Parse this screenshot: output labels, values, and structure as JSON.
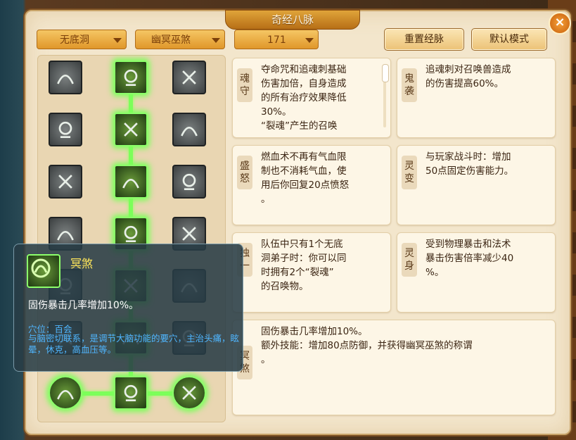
{
  "window": {
    "title": "奇经八脉",
    "close_label": "×"
  },
  "filters": {
    "school": "无底洞",
    "branch": "幽冥巫煞",
    "points": "171"
  },
  "buttons": {
    "reset": "重置经脉",
    "default": "默认模式"
  },
  "tree": {
    "rows": [
      [
        "inactive",
        "active",
        "inactive"
      ],
      [
        "inactive",
        "active",
        "inactive"
      ],
      [
        "inactive",
        "active",
        "inactive"
      ],
      [
        "inactive",
        "active",
        "inactive"
      ],
      [
        "inactive",
        "active",
        "inactive"
      ],
      [
        "inactive",
        "active",
        "inactive"
      ],
      [
        "active",
        "active",
        "active"
      ]
    ],
    "accent": "#7cff5a"
  },
  "skills": [
    {
      "name": "魂守",
      "desc": "夺命咒和追魂刺基础\n伤害加倍，自身造成\n的所有治疗效果降低\n30%。\n“裂魂”产生的召唤"
    },
    {
      "name": "鬼袭",
      "desc": "追魂刺对召唤兽造成\n的伤害提高60%。"
    },
    {
      "name": "盛怒",
      "desc": "燃血术不再有气血限\n制也不消耗气血，使\n用后你回复20点愤怒\n。"
    },
    {
      "name": "灵变",
      "desc": "与玩家战斗时：增加\n50点固定伤害能力。"
    },
    {
      "name": "独一",
      "desc": "队伍中只有1个无底\n洞弟子时：你可以同\n时拥有2个“裂魂”\n的召唤物。"
    },
    {
      "name": "灵身",
      "desc": "受到物理暴击和法术\n暴击伤害倍率减少40\n%。"
    },
    {
      "name": "冥煞",
      "desc": "固伤暴击几率增加10%。\n额外技能：增加80点防御，并获得幽冥巫煞的称谓\n。"
    }
  ],
  "tooltip": {
    "title": "冥煞",
    "effect": "固伤暴击几率增加10%。",
    "acupoint": "穴位：百会",
    "note": "与脑密切联系，是调节大脑功能的要穴，主治头痛，眩晕，休克，高血压等。"
  }
}
